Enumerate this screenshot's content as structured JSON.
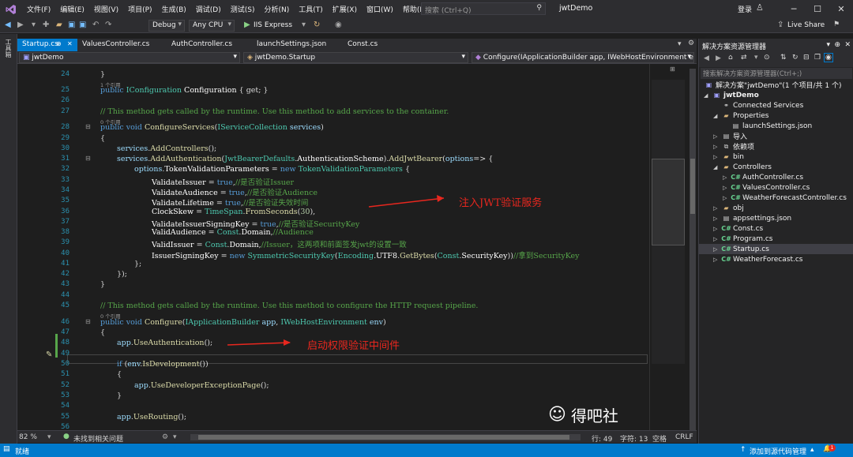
{
  "menubar": {
    "items": [
      "文件(F)",
      "编辑(E)",
      "视图(V)",
      "项目(P)",
      "生成(B)",
      "调试(D)",
      "测试(S)",
      "分析(N)",
      "工具(T)",
      "扩展(X)",
      "窗口(W)",
      "帮助(H)"
    ],
    "search_placeholder": "搜索 (Ctrl+Q)",
    "solution_name": "jwtDemo",
    "login": "登录",
    "live_share": "Live Share"
  },
  "toolbar": {
    "config": "Debug",
    "platform": "Any CPU",
    "run_target": "IIS Express"
  },
  "left_strip_label": "工具箱",
  "tabs": [
    {
      "label": "Startup.cs",
      "active": true
    },
    {
      "label": "ValuesController.cs",
      "active": false
    },
    {
      "label": "AuthController.cs",
      "active": false
    },
    {
      "label": "launchSettings.json",
      "active": false
    },
    {
      "label": "Const.cs",
      "active": false
    }
  ],
  "navbar": {
    "project": "jwtDemo",
    "class": "jwtDemo.Startup",
    "member": "Configure(IApplicationBuilder app, IWebHostEnvironment env)"
  },
  "code": {
    "line_numbers": [
      "24",
      "25",
      "26",
      "27",
      "28",
      "29",
      "30",
      "31",
      "32",
      "33",
      "34",
      "35",
      "36",
      "37",
      "38",
      "39",
      "40",
      "41",
      "42",
      "43",
      "44",
      "45",
      "46",
      "47",
      "48",
      "49",
      "50",
      "51",
      "52",
      "53",
      "54",
      "55",
      "56"
    ],
    "ref_label": "1 个引用",
    "ref_label_0": "0 个引用",
    "l24": "}",
    "l25_kw": "public",
    "l25_ty": "IConfiguration",
    "l25_pr": "Configuration",
    "l25_rest": "{ get; }",
    "l27": "// This method gets called by the runtime. Use this method to add services to the container.",
    "l28_kw": "public void",
    "l28_mt": "ConfigureServices",
    "l28_ty": "IServiceCollection",
    "l28_pm": "services",
    "l29": "{",
    "l30_pm": "services",
    "l30_mt": "AddControllers",
    "l30_rest": "();",
    "l31_pm": "services",
    "l31_mt": "AddAuthentication",
    "l31_ty": "JwtBearerDefaults",
    "l31_pr": "AuthenticationScheme",
    "l31_mt2": "AddJwtBearer",
    "l31_pm2": "options",
    "l31_rest": "=> {",
    "l32_pm": "options",
    "l32_pr": "TokenValidationParameters",
    "l32_kw": "new",
    "l32_ty": "TokenValidationParameters",
    "l32_rest": "{",
    "l33_pr": "ValidateIssuer",
    "l33_kw": "true",
    "l33_cm": "//是否验证Issuer",
    "l34_pr": "ValidateAudience",
    "l34_kw": "true",
    "l34_cm": "//是否验证Audience",
    "l35_pr": "ValidateLifetime",
    "l35_kw": "true",
    "l35_cm": "//是否验证失效时间",
    "l36_pr": "ClockSkew",
    "l36_ty": "TimeSpan",
    "l36_mt": "FromSeconds",
    "l36_nm": "30",
    "l37_pr": "ValidateIssuerSigningKey",
    "l37_kw": "true",
    "l37_cm": "//是否验证SecurityKey",
    "l38_pr": "ValidAudience",
    "l38_ty": "Const",
    "l38_pr2": "Domain",
    "l38_cm": "//Audience",
    "l39_pr": "ValidIssuer",
    "l39_ty": "Const",
    "l39_pr2": "Domain",
    "l39_cm": "//Issuer，这两项和前面签发jwt的设置一致",
    "l40_pr": "IssuerSigningKey",
    "l40_kw": "new",
    "l40_ty": "SymmetricSecurityKey",
    "l40_ty2": "Encoding",
    "l40_pr2": "UTF8",
    "l40_mt": "GetBytes",
    "l40_ty3": "Const",
    "l40_pr3": "SecurityKey",
    "l40_cm": "//拿到SecurityKey",
    "l41": "};",
    "l42": "});",
    "l43": "}",
    "l45": "// This method gets called by the runtime. Use this method to configure the HTTP request pipeline.",
    "l46_kw": "public void",
    "l46_mt": "Configure",
    "l46_ty": "IApplicationBuilder",
    "l46_pm": "app",
    "l46_ty2": "IWebHostEnvironment",
    "l46_pm2": "env",
    "l47": "{",
    "l48_pm": "app",
    "l48_mt": "UseAuthentication",
    "l48_rest": "();",
    "l50_kw": "if",
    "l50_pm": "env",
    "l50_mt": "IsDevelopment",
    "l51": "{",
    "l52_pm": "app",
    "l52_mt": "UseDeveloperExceptionPage",
    "l52_rest": "();",
    "l53": "}",
    "l55_pm": "app",
    "l55_mt": "UseRouting",
    "l55_rest": "();"
  },
  "annotations": {
    "jwt_service": "注入JWT验证服务",
    "auth_middleware": "启动权限验证中间件"
  },
  "watermark": "得吧社",
  "editor_status": {
    "zoom": "82 %",
    "issues": "未找到相关问题",
    "line": "行: 49",
    "col": "字符: 13",
    "space": "空格",
    "eol": "CRLF"
  },
  "statusbar": {
    "ready": "就绪",
    "source_control": "添加到源代码管理"
  },
  "solution_explorer": {
    "title": "解决方案资源管理器",
    "search_placeholder": "搜索解决方案资源管理器(Ctrl+;)",
    "solution": "解决方案\"jwtDemo\"(1 个项目/共 1 个)",
    "project": "jwtDemo",
    "items": [
      {
        "label": "Connected Services",
        "level": 2,
        "icon": "connected-icon",
        "expand": ""
      },
      {
        "label": "Properties",
        "level": 2,
        "icon": "wrench-folder-icon",
        "expand": "◢"
      },
      {
        "label": "launchSettings.json",
        "level": 3,
        "icon": "json-icon",
        "expand": ""
      },
      {
        "label": "导入",
        "level": 2,
        "icon": "import-icon",
        "expand": "▷"
      },
      {
        "label": "依赖项",
        "level": 2,
        "icon": "dependency-icon",
        "expand": "▷"
      },
      {
        "label": "bin",
        "level": 2,
        "icon": "folder-icon",
        "expand": "▷"
      },
      {
        "label": "Controllers",
        "level": 2,
        "icon": "folder-icon",
        "expand": "◢"
      },
      {
        "label": "AuthController.cs",
        "level": 3,
        "icon": "cs-icon",
        "expand": "▷"
      },
      {
        "label": "ValuesController.cs",
        "level": 3,
        "icon": "cs-icon",
        "expand": "▷"
      },
      {
        "label": "WeatherForecastController.cs",
        "level": 3,
        "icon": "cs-icon",
        "expand": "▷"
      },
      {
        "label": "obj",
        "level": 2,
        "icon": "folder-icon",
        "expand": "▷"
      },
      {
        "label": "appsettings.json",
        "level": 2,
        "icon": "json-icon",
        "expand": "▷"
      },
      {
        "label": "Const.cs",
        "level": 2,
        "icon": "cs-icon",
        "expand": "▷"
      },
      {
        "label": "Program.cs",
        "level": 2,
        "icon": "cs-icon",
        "expand": "▷"
      },
      {
        "label": "Startup.cs",
        "level": 2,
        "icon": "cs-icon",
        "expand": "▷",
        "selected": true
      },
      {
        "label": "WeatherForecast.cs",
        "level": 2,
        "icon": "cs-icon",
        "expand": "▷"
      }
    ]
  },
  "colors": {
    "accent": "#007acc",
    "annotation": "#e8271e"
  }
}
